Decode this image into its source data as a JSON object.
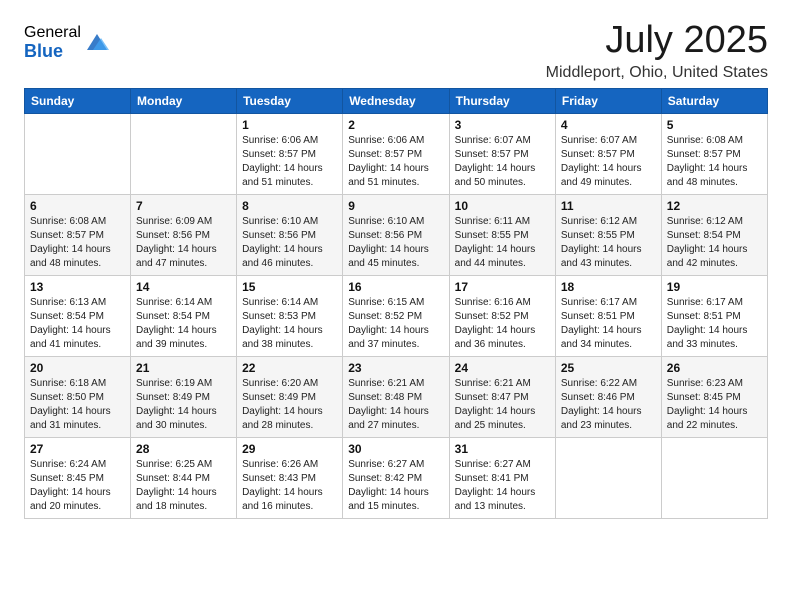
{
  "logo": {
    "general": "General",
    "blue": "Blue"
  },
  "title": "July 2025",
  "location": "Middleport, Ohio, United States",
  "weekdays": [
    "Sunday",
    "Monday",
    "Tuesday",
    "Wednesday",
    "Thursday",
    "Friday",
    "Saturday"
  ],
  "weeks": [
    [
      {
        "day": "",
        "info": ""
      },
      {
        "day": "",
        "info": ""
      },
      {
        "day": "1",
        "info": "Sunrise: 6:06 AM\nSunset: 8:57 PM\nDaylight: 14 hours and 51 minutes."
      },
      {
        "day": "2",
        "info": "Sunrise: 6:06 AM\nSunset: 8:57 PM\nDaylight: 14 hours and 51 minutes."
      },
      {
        "day": "3",
        "info": "Sunrise: 6:07 AM\nSunset: 8:57 PM\nDaylight: 14 hours and 50 minutes."
      },
      {
        "day": "4",
        "info": "Sunrise: 6:07 AM\nSunset: 8:57 PM\nDaylight: 14 hours and 49 minutes."
      },
      {
        "day": "5",
        "info": "Sunrise: 6:08 AM\nSunset: 8:57 PM\nDaylight: 14 hours and 48 minutes."
      }
    ],
    [
      {
        "day": "6",
        "info": "Sunrise: 6:08 AM\nSunset: 8:57 PM\nDaylight: 14 hours and 48 minutes."
      },
      {
        "day": "7",
        "info": "Sunrise: 6:09 AM\nSunset: 8:56 PM\nDaylight: 14 hours and 47 minutes."
      },
      {
        "day": "8",
        "info": "Sunrise: 6:10 AM\nSunset: 8:56 PM\nDaylight: 14 hours and 46 minutes."
      },
      {
        "day": "9",
        "info": "Sunrise: 6:10 AM\nSunset: 8:56 PM\nDaylight: 14 hours and 45 minutes."
      },
      {
        "day": "10",
        "info": "Sunrise: 6:11 AM\nSunset: 8:55 PM\nDaylight: 14 hours and 44 minutes."
      },
      {
        "day": "11",
        "info": "Sunrise: 6:12 AM\nSunset: 8:55 PM\nDaylight: 14 hours and 43 minutes."
      },
      {
        "day": "12",
        "info": "Sunrise: 6:12 AM\nSunset: 8:54 PM\nDaylight: 14 hours and 42 minutes."
      }
    ],
    [
      {
        "day": "13",
        "info": "Sunrise: 6:13 AM\nSunset: 8:54 PM\nDaylight: 14 hours and 41 minutes."
      },
      {
        "day": "14",
        "info": "Sunrise: 6:14 AM\nSunset: 8:54 PM\nDaylight: 14 hours and 39 minutes."
      },
      {
        "day": "15",
        "info": "Sunrise: 6:14 AM\nSunset: 8:53 PM\nDaylight: 14 hours and 38 minutes."
      },
      {
        "day": "16",
        "info": "Sunrise: 6:15 AM\nSunset: 8:52 PM\nDaylight: 14 hours and 37 minutes."
      },
      {
        "day": "17",
        "info": "Sunrise: 6:16 AM\nSunset: 8:52 PM\nDaylight: 14 hours and 36 minutes."
      },
      {
        "day": "18",
        "info": "Sunrise: 6:17 AM\nSunset: 8:51 PM\nDaylight: 14 hours and 34 minutes."
      },
      {
        "day": "19",
        "info": "Sunrise: 6:17 AM\nSunset: 8:51 PM\nDaylight: 14 hours and 33 minutes."
      }
    ],
    [
      {
        "day": "20",
        "info": "Sunrise: 6:18 AM\nSunset: 8:50 PM\nDaylight: 14 hours and 31 minutes."
      },
      {
        "day": "21",
        "info": "Sunrise: 6:19 AM\nSunset: 8:49 PM\nDaylight: 14 hours and 30 minutes."
      },
      {
        "day": "22",
        "info": "Sunrise: 6:20 AM\nSunset: 8:49 PM\nDaylight: 14 hours and 28 minutes."
      },
      {
        "day": "23",
        "info": "Sunrise: 6:21 AM\nSunset: 8:48 PM\nDaylight: 14 hours and 27 minutes."
      },
      {
        "day": "24",
        "info": "Sunrise: 6:21 AM\nSunset: 8:47 PM\nDaylight: 14 hours and 25 minutes."
      },
      {
        "day": "25",
        "info": "Sunrise: 6:22 AM\nSunset: 8:46 PM\nDaylight: 14 hours and 23 minutes."
      },
      {
        "day": "26",
        "info": "Sunrise: 6:23 AM\nSunset: 8:45 PM\nDaylight: 14 hours and 22 minutes."
      }
    ],
    [
      {
        "day": "27",
        "info": "Sunrise: 6:24 AM\nSunset: 8:45 PM\nDaylight: 14 hours and 20 minutes."
      },
      {
        "day": "28",
        "info": "Sunrise: 6:25 AM\nSunset: 8:44 PM\nDaylight: 14 hours and 18 minutes."
      },
      {
        "day": "29",
        "info": "Sunrise: 6:26 AM\nSunset: 8:43 PM\nDaylight: 14 hours and 16 minutes."
      },
      {
        "day": "30",
        "info": "Sunrise: 6:27 AM\nSunset: 8:42 PM\nDaylight: 14 hours and 15 minutes."
      },
      {
        "day": "31",
        "info": "Sunrise: 6:27 AM\nSunset: 8:41 PM\nDaylight: 14 hours and 13 minutes."
      },
      {
        "day": "",
        "info": ""
      },
      {
        "day": "",
        "info": ""
      }
    ]
  ]
}
